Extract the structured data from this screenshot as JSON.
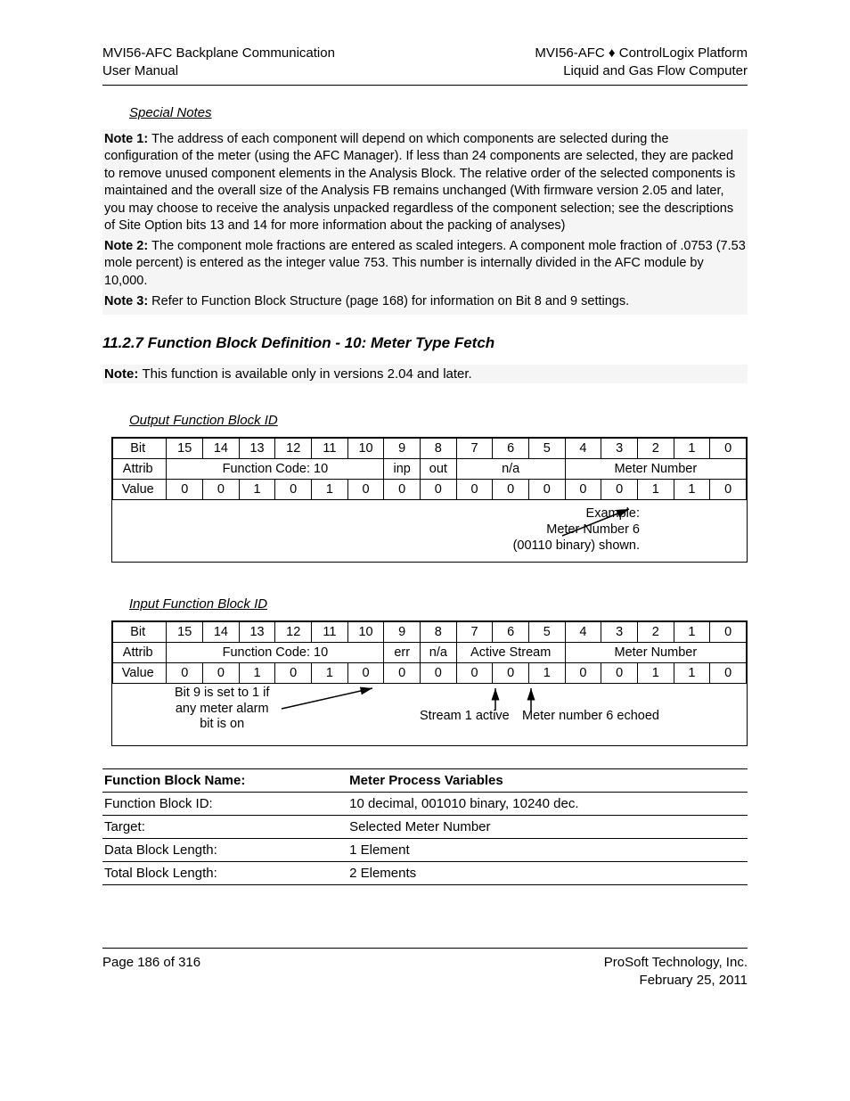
{
  "header": {
    "left_line1": "MVI56-AFC Backplane Communication",
    "left_line2": "User Manual",
    "right_line1": "MVI56-AFC ♦ ControlLogix Platform",
    "right_line2": "Liquid and Gas Flow Computer"
  },
  "special_notes_title": "Special Notes",
  "notes": {
    "n1_label": "Note 1: ",
    "n1_text": "The address of each component will depend on which components are selected during the configuration of the meter (using the AFC Manager). If less than 24 components are selected, they are packed to remove unused component elements in the Analysis Block. The relative order of the selected components is maintained and the overall size of the Analysis FB remains unchanged (With firmware version 2.05 and later, you may choose to receive the analysis unpacked regardless of the component selection; see the descriptions of Site Option bits 13 and 14 for more information about the packing of analyses)",
    "n2_label": "Note 2: ",
    "n2_text": "The component mole fractions are entered as scaled integers. A component mole fraction of .0753 (7.53 mole percent) is entered as the integer value 753. This number is internally divided in the AFC module by 10,000.",
    "n3_label": "Note 3: ",
    "n3_text": "Refer to Function Block Structure (page 168) for information on Bit 8 and 9 settings."
  },
  "section_heading": "11.2.7 Function Block Definition - 10: Meter Type Fetch",
  "note_2_04_label": "Note: ",
  "note_2_04_text": "This function is available only in versions 2.04 and later.",
  "output_block": {
    "heading": "Output Function Block ID",
    "row_labels": {
      "bit": "Bit",
      "attrib": "Attrib",
      "value": "Value"
    },
    "bits": [
      "15",
      "14",
      "13",
      "12",
      "11",
      "10",
      "9",
      "8",
      "7",
      "6",
      "5",
      "4",
      "3",
      "2",
      "1",
      "0"
    ],
    "attribs": {
      "func_code": "Function Code: 10",
      "inp": "inp",
      "out": "out",
      "na": "n/a",
      "meter_number": "Meter Number"
    },
    "values": [
      "0",
      "0",
      "1",
      "0",
      "1",
      "0",
      "0",
      "0",
      "0",
      "0",
      "0",
      "0",
      "0",
      "1",
      "1",
      "0"
    ],
    "annot": {
      "l1": "Example:",
      "l2": "Meter Number 6",
      "l3": "(00110 binary) shown."
    }
  },
  "input_block": {
    "heading": "Input Function Block ID",
    "row_labels": {
      "bit": "Bit",
      "attrib": "Attrib",
      "value": "Value"
    },
    "bits": [
      "15",
      "14",
      "13",
      "12",
      "11",
      "10",
      "9",
      "8",
      "7",
      "6",
      "5",
      "4",
      "3",
      "2",
      "1",
      "0"
    ],
    "attribs": {
      "func_code": "Function Code: 10",
      "err": "err",
      "na": "n/a",
      "active_stream": "Active Stream",
      "meter_number": "Meter Number"
    },
    "values": [
      "0",
      "0",
      "1",
      "0",
      "1",
      "0",
      "0",
      "0",
      "0",
      "0",
      "1",
      "0",
      "0",
      "1",
      "1",
      "0"
    ],
    "left_note_l1": "Bit 9 is set to 1 if",
    "left_note_l2": "any meter alarm",
    "left_note_l3": "bit is on",
    "mid_note": "Stream 1 active",
    "right_note": "Meter number 6 echoed"
  },
  "info_table": {
    "r1_k": "Function Block Name:",
    "r1_v": "Meter Process Variables",
    "r2_k": "Function Block ID:",
    "r2_v": "10 decimal, 001010 binary, 10240 dec.",
    "r3_k": "Target:",
    "r3_v": "Selected Meter Number",
    "r4_k": "Data Block Length:",
    "r4_v": "1 Element",
    "r5_k": "Total Block Length:",
    "r5_v": "2 Elements"
  },
  "footer": {
    "left": "Page 186 of 316",
    "right_line1": "ProSoft Technology, Inc.",
    "right_line2": "February 25, 2011"
  }
}
